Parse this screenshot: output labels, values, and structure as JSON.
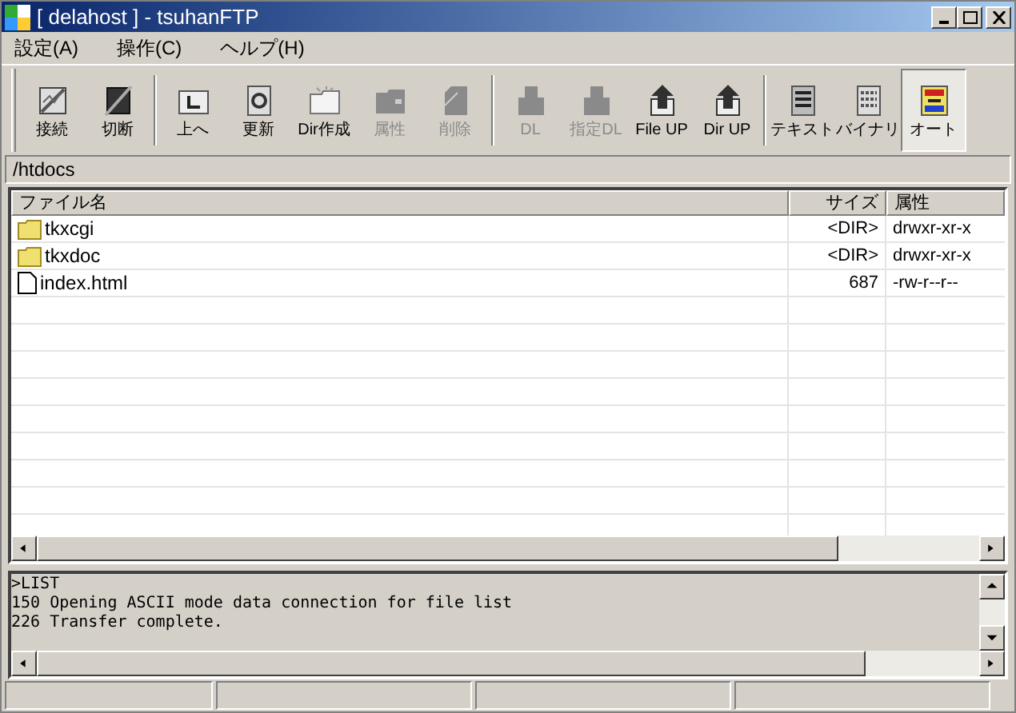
{
  "window": {
    "title": "[ delahost ] - tsuhanFTP"
  },
  "menu": [
    "設定(A)",
    "操作(C)",
    "ヘルプ(H)"
  ],
  "toolbar_groups": [
    [
      {
        "label": "接続",
        "kind": "connect",
        "disabled": false,
        "selected": false
      },
      {
        "label": "切断",
        "kind": "disconnect",
        "disabled": false,
        "selected": false
      }
    ],
    [
      {
        "label": "上へ",
        "kind": "up",
        "disabled": false,
        "selected": false
      },
      {
        "label": "更新",
        "kind": "refresh",
        "disabled": false,
        "selected": false
      },
      {
        "label": "Dir作成",
        "kind": "newdir",
        "disabled": false,
        "selected": false
      },
      {
        "label": "属性",
        "kind": "folder",
        "disabled": true,
        "selected": false
      },
      {
        "label": "削除",
        "kind": "file",
        "disabled": true,
        "selected": false
      }
    ],
    [
      {
        "label": "DL",
        "kind": "download",
        "disabled": true,
        "selected": false
      },
      {
        "label": "指定DL",
        "kind": "download",
        "disabled": true,
        "selected": false
      },
      {
        "label": "File UP",
        "kind": "upload",
        "disabled": false,
        "selected": false
      },
      {
        "label": "Dir UP",
        "kind": "upload",
        "disabled": false,
        "selected": false
      }
    ],
    [
      {
        "label": "テキスト",
        "kind": "text",
        "disabled": false,
        "selected": false
      },
      {
        "label": "バイナリ",
        "kind": "binary",
        "disabled": false,
        "selected": false
      },
      {
        "label": "オート",
        "kind": "auto",
        "disabled": false,
        "selected": true
      }
    ]
  ],
  "path": "/htdocs",
  "table": {
    "columns": [
      "ファイル名",
      "サイズ",
      "属性"
    ],
    "rows": [
      {
        "kind": "folder",
        "name": "tkxcgi",
        "size": "<DIR>",
        "attributes": "drwxr-xr-x"
      },
      {
        "kind": "folder",
        "name": "tkxdoc",
        "size": "<DIR>",
        "attributes": "drwxr-xr-x"
      },
      {
        "kind": "file",
        "name": "index.html",
        "size": "687",
        "attributes": "-rw-r--r--"
      }
    ]
  },
  "log": [
    ">LIST",
    "150 Opening ASCII mode data connection for file list",
    "226 Transfer complete."
  ]
}
